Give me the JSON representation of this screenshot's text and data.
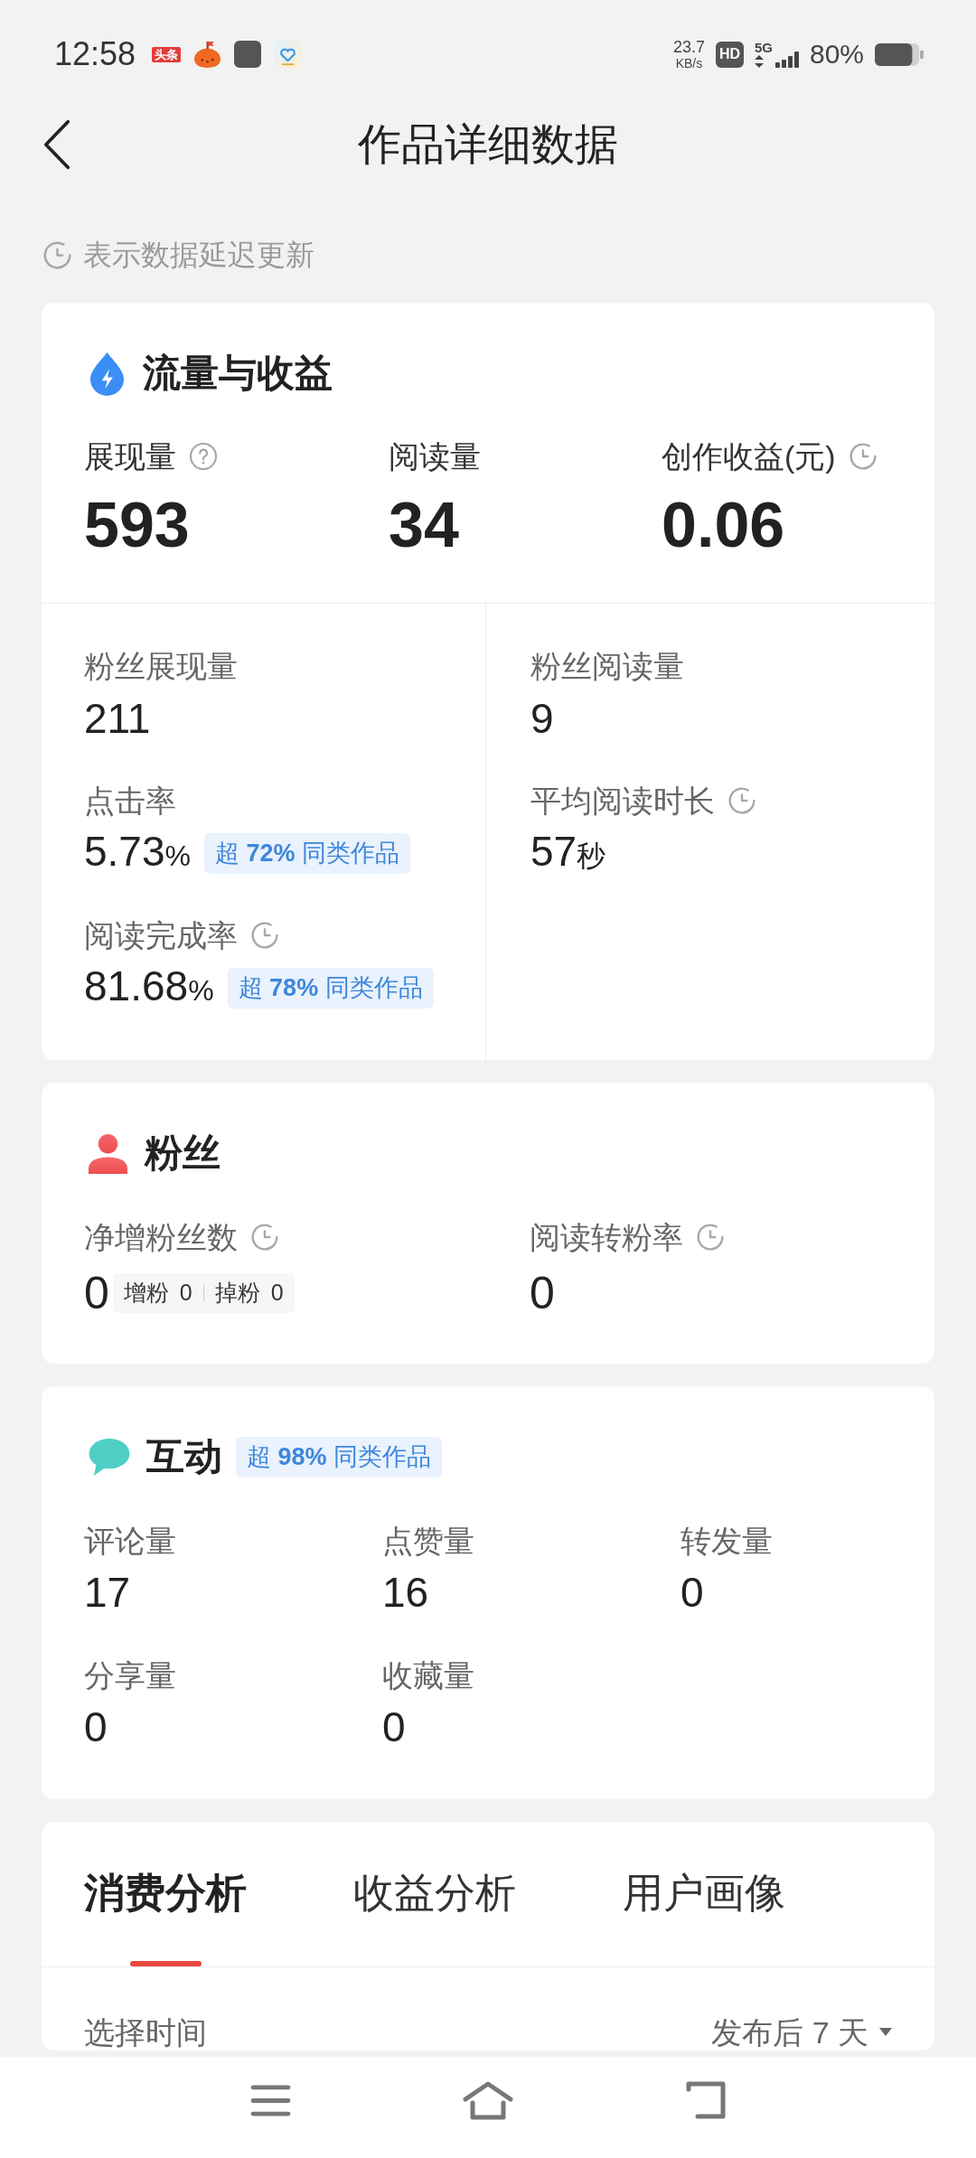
{
  "status_bar": {
    "time": "12:58",
    "app_badge": "头条",
    "net_speed": "23.7",
    "net_unit": "KB/s",
    "hd": "HD",
    "network": "5G",
    "battery": "80%"
  },
  "header": {
    "title": "作品详细数据"
  },
  "notice": "表示数据延迟更新",
  "sections": [
    {
      "kind": "traffic",
      "title": "流量与收益",
      "headline": [
        {
          "label": "展现量",
          "value": "593",
          "help": true,
          "delayed": false
        },
        {
          "label": "阅读量",
          "value": "34",
          "help": false,
          "delayed": false
        },
        {
          "label": "创作收益(元)",
          "value": "0.06",
          "help": false,
          "delayed": true
        }
      ],
      "details": [
        [
          {
            "label": "粉丝展现量",
            "value": "211",
            "help": false,
            "delayed": false
          },
          {
            "label": "点击率",
            "value": "5.73",
            "unit": "%",
            "badge": "超 **72%** 同类作品",
            "help": false,
            "delayed": false
          },
          {
            "label": "阅读完成率",
            "value": "81.68",
            "unit": "%",
            "badge": "超 **78%** 同类作品",
            "help": false,
            "delayed": true
          }
        ],
        [
          {
            "label": "粉丝阅读量",
            "value": "9",
            "help": false,
            "delayed": false
          },
          {
            "label": "平均阅读时长",
            "value": "57",
            "unit": "秒",
            "help": false,
            "delayed": true
          }
        ]
      ]
    },
    {
      "kind": "fans",
      "title": "粉丝",
      "metrics": [
        {
          "label": "净增粉丝数",
          "value": "0",
          "help": false,
          "delayed": true,
          "breakdown": [
            {
              "label": "增粉",
              "value": "0"
            },
            {
              "label": "掉粉",
              "value": "0"
            }
          ]
        },
        {
          "label": "阅读转粉率",
          "value": "0",
          "help": false,
          "delayed": true
        }
      ]
    },
    {
      "kind": "interaction",
      "title": "互动",
      "badge": "超 **98%** 同类作品",
      "metrics": [
        {
          "label": "评论量",
          "value": "17",
          "help": false,
          "delayed": false
        },
        {
          "label": "点赞量",
          "value": "16",
          "help": false,
          "delayed": false
        },
        {
          "label": "转发量",
          "value": "0",
          "help": false,
          "delayed": false
        },
        {
          "label": "分享量",
          "value": "0",
          "help": false,
          "delayed": false
        },
        {
          "label": "收藏量",
          "value": "0",
          "help": false,
          "delayed": false
        }
      ]
    }
  ],
  "analysis": {
    "tabs": [
      {
        "label": "消费分析",
        "selected": true
      },
      {
        "label": "收益分析",
        "selected": false
      },
      {
        "label": "用户画像",
        "selected": false
      }
    ],
    "filter": {
      "label": "选择时间",
      "value": "发布后 7 天"
    }
  }
}
